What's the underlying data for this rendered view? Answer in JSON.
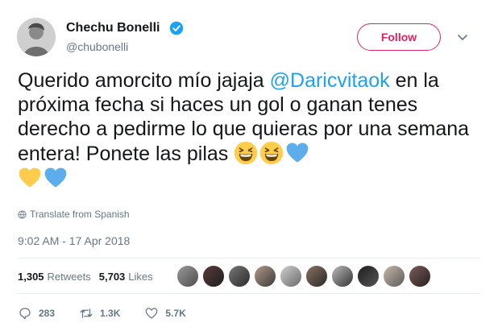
{
  "user": {
    "name": "Chechu Bonelli",
    "handle": "@chubonelli",
    "verified": true
  },
  "follow_label": "Follow",
  "tweet": {
    "text_before": "Querido amorcito mío jajaja  ",
    "mention": "@Daricvitaok",
    "text_after": " en la próxima fecha si haces un gol o ganan tenes derecho a pedirme lo que quieras por una semana entera! Ponete las pilas ",
    "emojis": [
      "grinning-squinting-face",
      "grinning-squinting-face",
      "blue-heart",
      "yellow-heart",
      "blue-heart"
    ]
  },
  "translate_label": "Translate from Spanish",
  "timestamp": "9:02 AM - 17 Apr 2018",
  "stats": {
    "retweets_count": "1,305",
    "retweets_label": "Retweets",
    "likes_count": "5,703",
    "likes_label": "Likes"
  },
  "likers": [
    "liker-1",
    "liker-2",
    "liker-3",
    "liker-4",
    "liker-5",
    "liker-6",
    "liker-7",
    "liker-8",
    "liker-9",
    "liker-10"
  ],
  "actions": {
    "replies": "283",
    "retweets": "1.3K",
    "likes": "5.7K"
  },
  "colors": {
    "accent": "#1da1f2",
    "follow": "#e0245e",
    "muted": "#657786"
  }
}
